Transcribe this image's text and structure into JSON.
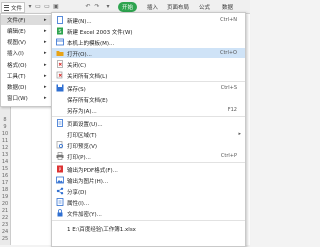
{
  "toolbar": {
    "menu_label": "文件",
    "active_tab": "开始",
    "tabs": [
      "插入",
      "页面布局",
      "公式",
      "数据"
    ]
  },
  "left_menu": {
    "items": [
      {
        "label": "文件(F)",
        "key": "",
        "selected": true
      },
      {
        "label": "编辑(E)",
        "key": ""
      },
      {
        "label": "视图(V)",
        "key": ""
      },
      {
        "label": "插入(I)",
        "key": ""
      },
      {
        "label": "格式(O)",
        "key": ""
      },
      {
        "label": "工具(T)",
        "key": ""
      },
      {
        "label": "数据(D)",
        "key": ""
      },
      {
        "label": "窗口(W)",
        "key": ""
      }
    ]
  },
  "submenu": {
    "items": [
      {
        "label": "新建(N)...",
        "shortcut": "Ctrl+N",
        "icon": "new-file-icon",
        "color": "#2f6fd1"
      },
      {
        "label": "新建 Excel 2003 文件(W)",
        "shortcut": "",
        "icon": "excel-file-icon",
        "color": "#2ea44f"
      },
      {
        "label": "本机上的模板(M)...",
        "shortcut": "",
        "icon": "template-icon",
        "color": "#2f6fd1"
      },
      {
        "label": "打开(O)...",
        "shortcut": "Ctrl+O",
        "icon": "open-folder-icon",
        "color": "#e8a317",
        "highlight": true
      },
      {
        "label": "关闭(C)",
        "shortcut": "",
        "icon": "close-doc-icon",
        "color": "#d33"
      },
      {
        "label": "关闭所有文档(L)",
        "shortcut": "",
        "icon": "close-all-icon",
        "color": "#d33"
      },
      {
        "label": "保存(S)",
        "shortcut": "Ctrl+S",
        "icon": "save-icon",
        "color": "#2f6fd1"
      },
      {
        "label": "保存所有文档(E)",
        "shortcut": "",
        "icon": "save-all-icon",
        "color": "#2f6fd1"
      },
      {
        "label": "另存为(A)...",
        "shortcut": "F12",
        "icon": "save-as-icon",
        "color": "#2f6fd1"
      },
      {
        "label": "页面设置(U)...",
        "shortcut": "",
        "icon": "page-setup-icon",
        "color": "#2f6fd1"
      },
      {
        "label": "打印区域(T)",
        "shortcut": "",
        "icon": "",
        "arrow": true
      },
      {
        "label": "打印预览(V)",
        "shortcut": "",
        "icon": "print-preview-icon",
        "color": "#2f6fd1"
      },
      {
        "label": "打印(P)...",
        "shortcut": "Ctrl+P",
        "icon": "print-icon",
        "color": "#2f6fd1"
      },
      {
        "label": "输出为PDF格式(F)...",
        "shortcut": "",
        "icon": "pdf-icon",
        "color": "#d33"
      },
      {
        "label": "输出为图片(H)...",
        "shortcut": "",
        "icon": "image-export-icon",
        "color": "#2f6fd1"
      },
      {
        "label": "分享(D)",
        "shortcut": "",
        "icon": "share-icon",
        "color": "#2f6fd1"
      },
      {
        "label": "属性(I)...",
        "shortcut": "",
        "icon": "properties-icon",
        "color": "#2f6fd1"
      },
      {
        "label": "文件加密(Y)...",
        "shortcut": "",
        "icon": "encrypt-icon",
        "color": "#2f6fd1"
      },
      {
        "label": "1 E:\\百度经验\\工作簿1.xlsx",
        "shortcut": "",
        "icon": ""
      }
    ]
  },
  "row_numbers": [
    "8",
    "9",
    "10",
    "11",
    "12",
    "13",
    "14",
    "15",
    "16",
    "17",
    "18",
    "19",
    "20",
    "21",
    "22",
    "23",
    "24",
    "25"
  ]
}
